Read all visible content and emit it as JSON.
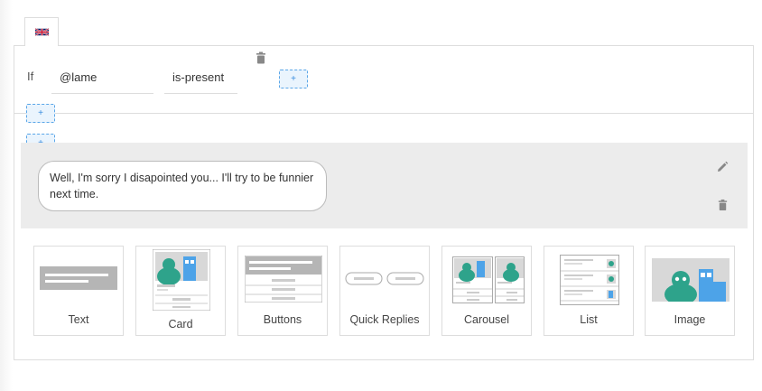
{
  "tabs": [
    {
      "language": "English",
      "icon": "uk-flag-icon"
    }
  ],
  "condition": {
    "if_label": "If",
    "variable": "@lame",
    "operator": "is-present",
    "add_label": "+"
  },
  "add_buttons": [
    "+",
    "+"
  ],
  "message": {
    "text": "Well, I'm sorry I disapointed you... I'll try to be funnier next time."
  },
  "message_types": [
    {
      "label": "Text",
      "icon": "text-type-icon"
    },
    {
      "label": "Card",
      "icon": "card-type-icon"
    },
    {
      "label": "Buttons",
      "icon": "buttons-type-icon"
    },
    {
      "label": "Quick Replies",
      "icon": "quick-replies-type-icon"
    },
    {
      "label": "Carousel",
      "icon": "carousel-type-icon"
    },
    {
      "label": "List",
      "icon": "list-type-icon"
    },
    {
      "label": "Image",
      "icon": "image-type-icon"
    }
  ],
  "colors": {
    "accent": "#3a8ee0",
    "robot_teal": "#2ea38b",
    "robot_blue": "#4da3e8",
    "band": "#ececec"
  }
}
